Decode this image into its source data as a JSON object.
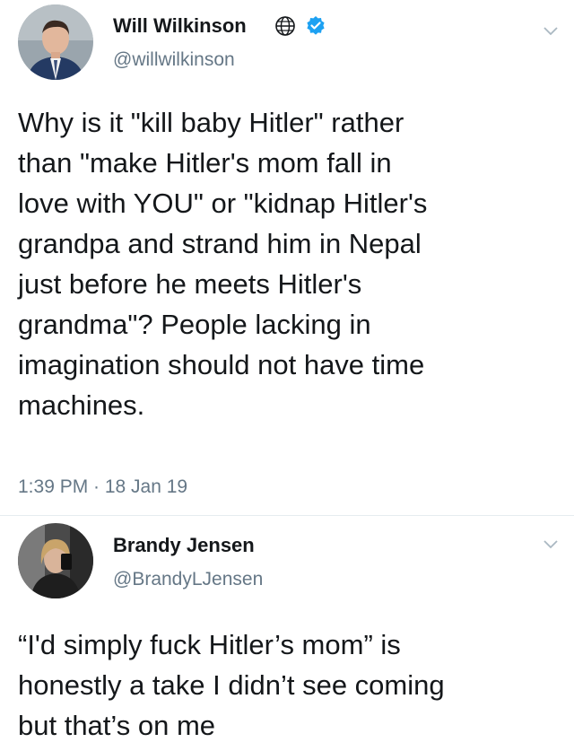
{
  "tweets": [
    {
      "author_name": "Will Wilkinson",
      "author_handle": "@willwilkinson",
      "verified": true,
      "text": "Why is it \"kill baby Hitler\" rather\nthan \"make Hitler's mom fall in\nlove with YOU\" or \"kidnap Hitler's\ngrandpa and strand him in Nepal\njust before he meets Hitler's\ngrandma\"?  People lacking in\nimagination should not have time\nmachines.",
      "timestamp": "1:39 PM · 18 Jan 19",
      "icons": [
        "avatar",
        "globe-icon",
        "verified-badge-icon",
        "chevron-down-icon"
      ],
      "accent_color": "#1da1f2"
    },
    {
      "author_name": "Brandy Jensen",
      "author_handle": "@BrandyLJensen",
      "text": "“I'd simply fuck Hitler’s mom” is\nhonestly a take I didn’t see coming\nbut that’s on me",
      "icons": [
        "avatar",
        "chevron-down-icon"
      ]
    }
  ]
}
